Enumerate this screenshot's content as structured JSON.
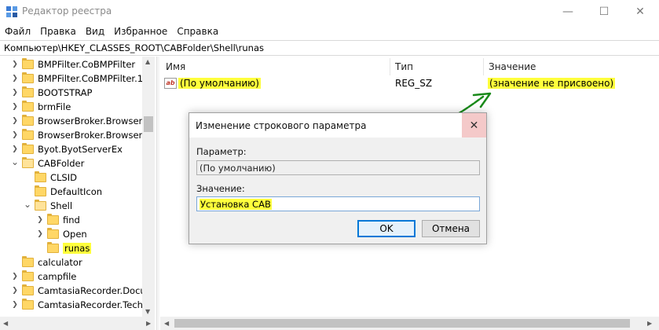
{
  "window": {
    "title": "Редактор реестра",
    "minimize_glyph": "—",
    "maximize_glyph": "☐",
    "close_glyph": "✕"
  },
  "menu": [
    "Файл",
    "Правка",
    "Вид",
    "Избранное",
    "Справка"
  ],
  "address": "Компьютер\\HKEY_CLASSES_ROOT\\CABFolder\\Shell\\runas",
  "tree": {
    "items": [
      {
        "label": "BMPFilter.CoBMPFilter",
        "depth": 0,
        "expander": ">"
      },
      {
        "label": "BMPFilter.CoBMPFilter.1",
        "depth": 0,
        "expander": ">"
      },
      {
        "label": "BOOTSTRAP",
        "depth": 0,
        "expander": ">"
      },
      {
        "label": "brmFile",
        "depth": 0,
        "expander": ">"
      },
      {
        "label": "BrowserBroker.BrowserBr",
        "depth": 0,
        "expander": ">"
      },
      {
        "label": "BrowserBroker.BrowserBr",
        "depth": 0,
        "expander": ">"
      },
      {
        "label": "Byot.ByotServerEx",
        "depth": 0,
        "expander": ">"
      },
      {
        "label": "CABFolder",
        "depth": 0,
        "expander": "v"
      },
      {
        "label": "CLSID",
        "depth": 1,
        "expander": ""
      },
      {
        "label": "DefaultIcon",
        "depth": 1,
        "expander": ""
      },
      {
        "label": "Shell",
        "depth": 1,
        "expander": "v"
      },
      {
        "label": "find",
        "depth": 2,
        "expander": ">"
      },
      {
        "label": "Open",
        "depth": 2,
        "expander": ">"
      },
      {
        "label": "runas",
        "depth": 2,
        "expander": "",
        "highlight": true
      },
      {
        "label": "calculator",
        "depth": 0,
        "expander": ""
      },
      {
        "label": "campfile",
        "depth": 0,
        "expander": ">"
      },
      {
        "label": "CamtasiaRecorder.Docun",
        "depth": 0,
        "expander": ">"
      },
      {
        "label": "CamtasiaRecorder.TechSr",
        "depth": 0,
        "expander": ">"
      }
    ]
  },
  "values": {
    "columns": {
      "name": "Имя",
      "type": "Тип",
      "value": "Значение"
    },
    "rows": [
      {
        "name": "(По умолчанию)",
        "type": "REG_SZ",
        "value": "(значение не присвоено)",
        "icon": "ab"
      }
    ]
  },
  "dialog": {
    "title": "Изменение строкового параметра",
    "param_label": "Параметр:",
    "param_value": "(По умолчанию)",
    "value_label": "Значение:",
    "value_value": "Установка CAB",
    "ok_label": "OK",
    "cancel_label": "Отмена"
  },
  "colors": {
    "highlight": "#ffff3c",
    "arrow": "#1a8a1a",
    "accent": "#0078d7"
  }
}
